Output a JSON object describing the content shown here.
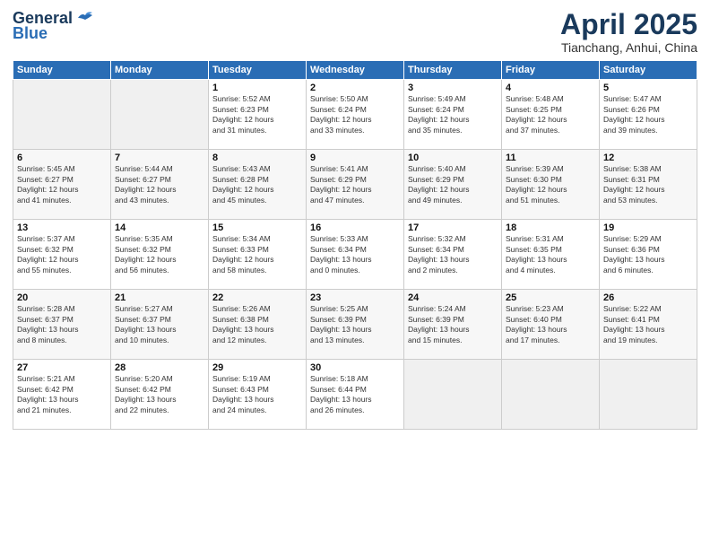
{
  "header": {
    "logo_general": "General",
    "logo_blue": "Blue",
    "month": "April 2025",
    "location": "Tianchang, Anhui, China"
  },
  "weekdays": [
    "Sunday",
    "Monday",
    "Tuesday",
    "Wednesday",
    "Thursday",
    "Friday",
    "Saturday"
  ],
  "weeks": [
    [
      {
        "day": "",
        "sunrise": "",
        "sunset": "",
        "daylight": ""
      },
      {
        "day": "",
        "sunrise": "",
        "sunset": "",
        "daylight": ""
      },
      {
        "day": "1",
        "sunrise": "Sunrise: 5:52 AM",
        "sunset": "Sunset: 6:23 PM",
        "daylight": "Daylight: 12 hours and 31 minutes."
      },
      {
        "day": "2",
        "sunrise": "Sunrise: 5:50 AM",
        "sunset": "Sunset: 6:24 PM",
        "daylight": "Daylight: 12 hours and 33 minutes."
      },
      {
        "day": "3",
        "sunrise": "Sunrise: 5:49 AM",
        "sunset": "Sunset: 6:24 PM",
        "daylight": "Daylight: 12 hours and 35 minutes."
      },
      {
        "day": "4",
        "sunrise": "Sunrise: 5:48 AM",
        "sunset": "Sunset: 6:25 PM",
        "daylight": "Daylight: 12 hours and 37 minutes."
      },
      {
        "day": "5",
        "sunrise": "Sunrise: 5:47 AM",
        "sunset": "Sunset: 6:26 PM",
        "daylight": "Daylight: 12 hours and 39 minutes."
      }
    ],
    [
      {
        "day": "6",
        "sunrise": "Sunrise: 5:45 AM",
        "sunset": "Sunset: 6:27 PM",
        "daylight": "Daylight: 12 hours and 41 minutes."
      },
      {
        "day": "7",
        "sunrise": "Sunrise: 5:44 AM",
        "sunset": "Sunset: 6:27 PM",
        "daylight": "Daylight: 12 hours and 43 minutes."
      },
      {
        "day": "8",
        "sunrise": "Sunrise: 5:43 AM",
        "sunset": "Sunset: 6:28 PM",
        "daylight": "Daylight: 12 hours and 45 minutes."
      },
      {
        "day": "9",
        "sunrise": "Sunrise: 5:41 AM",
        "sunset": "Sunset: 6:29 PM",
        "daylight": "Daylight: 12 hours and 47 minutes."
      },
      {
        "day": "10",
        "sunrise": "Sunrise: 5:40 AM",
        "sunset": "Sunset: 6:29 PM",
        "daylight": "Daylight: 12 hours and 49 minutes."
      },
      {
        "day": "11",
        "sunrise": "Sunrise: 5:39 AM",
        "sunset": "Sunset: 6:30 PM",
        "daylight": "Daylight: 12 hours and 51 minutes."
      },
      {
        "day": "12",
        "sunrise": "Sunrise: 5:38 AM",
        "sunset": "Sunset: 6:31 PM",
        "daylight": "Daylight: 12 hours and 53 minutes."
      }
    ],
    [
      {
        "day": "13",
        "sunrise": "Sunrise: 5:37 AM",
        "sunset": "Sunset: 6:32 PM",
        "daylight": "Daylight: 12 hours and 55 minutes."
      },
      {
        "day": "14",
        "sunrise": "Sunrise: 5:35 AM",
        "sunset": "Sunset: 6:32 PM",
        "daylight": "Daylight: 12 hours and 56 minutes."
      },
      {
        "day": "15",
        "sunrise": "Sunrise: 5:34 AM",
        "sunset": "Sunset: 6:33 PM",
        "daylight": "Daylight: 12 hours and 58 minutes."
      },
      {
        "day": "16",
        "sunrise": "Sunrise: 5:33 AM",
        "sunset": "Sunset: 6:34 PM",
        "daylight": "Daylight: 13 hours and 0 minutes."
      },
      {
        "day": "17",
        "sunrise": "Sunrise: 5:32 AM",
        "sunset": "Sunset: 6:34 PM",
        "daylight": "Daylight: 13 hours and 2 minutes."
      },
      {
        "day": "18",
        "sunrise": "Sunrise: 5:31 AM",
        "sunset": "Sunset: 6:35 PM",
        "daylight": "Daylight: 13 hours and 4 minutes."
      },
      {
        "day": "19",
        "sunrise": "Sunrise: 5:29 AM",
        "sunset": "Sunset: 6:36 PM",
        "daylight": "Daylight: 13 hours and 6 minutes."
      }
    ],
    [
      {
        "day": "20",
        "sunrise": "Sunrise: 5:28 AM",
        "sunset": "Sunset: 6:37 PM",
        "daylight": "Daylight: 13 hours and 8 minutes."
      },
      {
        "day": "21",
        "sunrise": "Sunrise: 5:27 AM",
        "sunset": "Sunset: 6:37 PM",
        "daylight": "Daylight: 13 hours and 10 minutes."
      },
      {
        "day": "22",
        "sunrise": "Sunrise: 5:26 AM",
        "sunset": "Sunset: 6:38 PM",
        "daylight": "Daylight: 13 hours and 12 minutes."
      },
      {
        "day": "23",
        "sunrise": "Sunrise: 5:25 AM",
        "sunset": "Sunset: 6:39 PM",
        "daylight": "Daylight: 13 hours and 13 minutes."
      },
      {
        "day": "24",
        "sunrise": "Sunrise: 5:24 AM",
        "sunset": "Sunset: 6:39 PM",
        "daylight": "Daylight: 13 hours and 15 minutes."
      },
      {
        "day": "25",
        "sunrise": "Sunrise: 5:23 AM",
        "sunset": "Sunset: 6:40 PM",
        "daylight": "Daylight: 13 hours and 17 minutes."
      },
      {
        "day": "26",
        "sunrise": "Sunrise: 5:22 AM",
        "sunset": "Sunset: 6:41 PM",
        "daylight": "Daylight: 13 hours and 19 minutes."
      }
    ],
    [
      {
        "day": "27",
        "sunrise": "Sunrise: 5:21 AM",
        "sunset": "Sunset: 6:42 PM",
        "daylight": "Daylight: 13 hours and 21 minutes."
      },
      {
        "day": "28",
        "sunrise": "Sunrise: 5:20 AM",
        "sunset": "Sunset: 6:42 PM",
        "daylight": "Daylight: 13 hours and 22 minutes."
      },
      {
        "day": "29",
        "sunrise": "Sunrise: 5:19 AM",
        "sunset": "Sunset: 6:43 PM",
        "daylight": "Daylight: 13 hours and 24 minutes."
      },
      {
        "day": "30",
        "sunrise": "Sunrise: 5:18 AM",
        "sunset": "Sunset: 6:44 PM",
        "daylight": "Daylight: 13 hours and 26 minutes."
      },
      {
        "day": "",
        "sunrise": "",
        "sunset": "",
        "daylight": ""
      },
      {
        "day": "",
        "sunrise": "",
        "sunset": "",
        "daylight": ""
      },
      {
        "day": "",
        "sunrise": "",
        "sunset": "",
        "daylight": ""
      }
    ]
  ]
}
